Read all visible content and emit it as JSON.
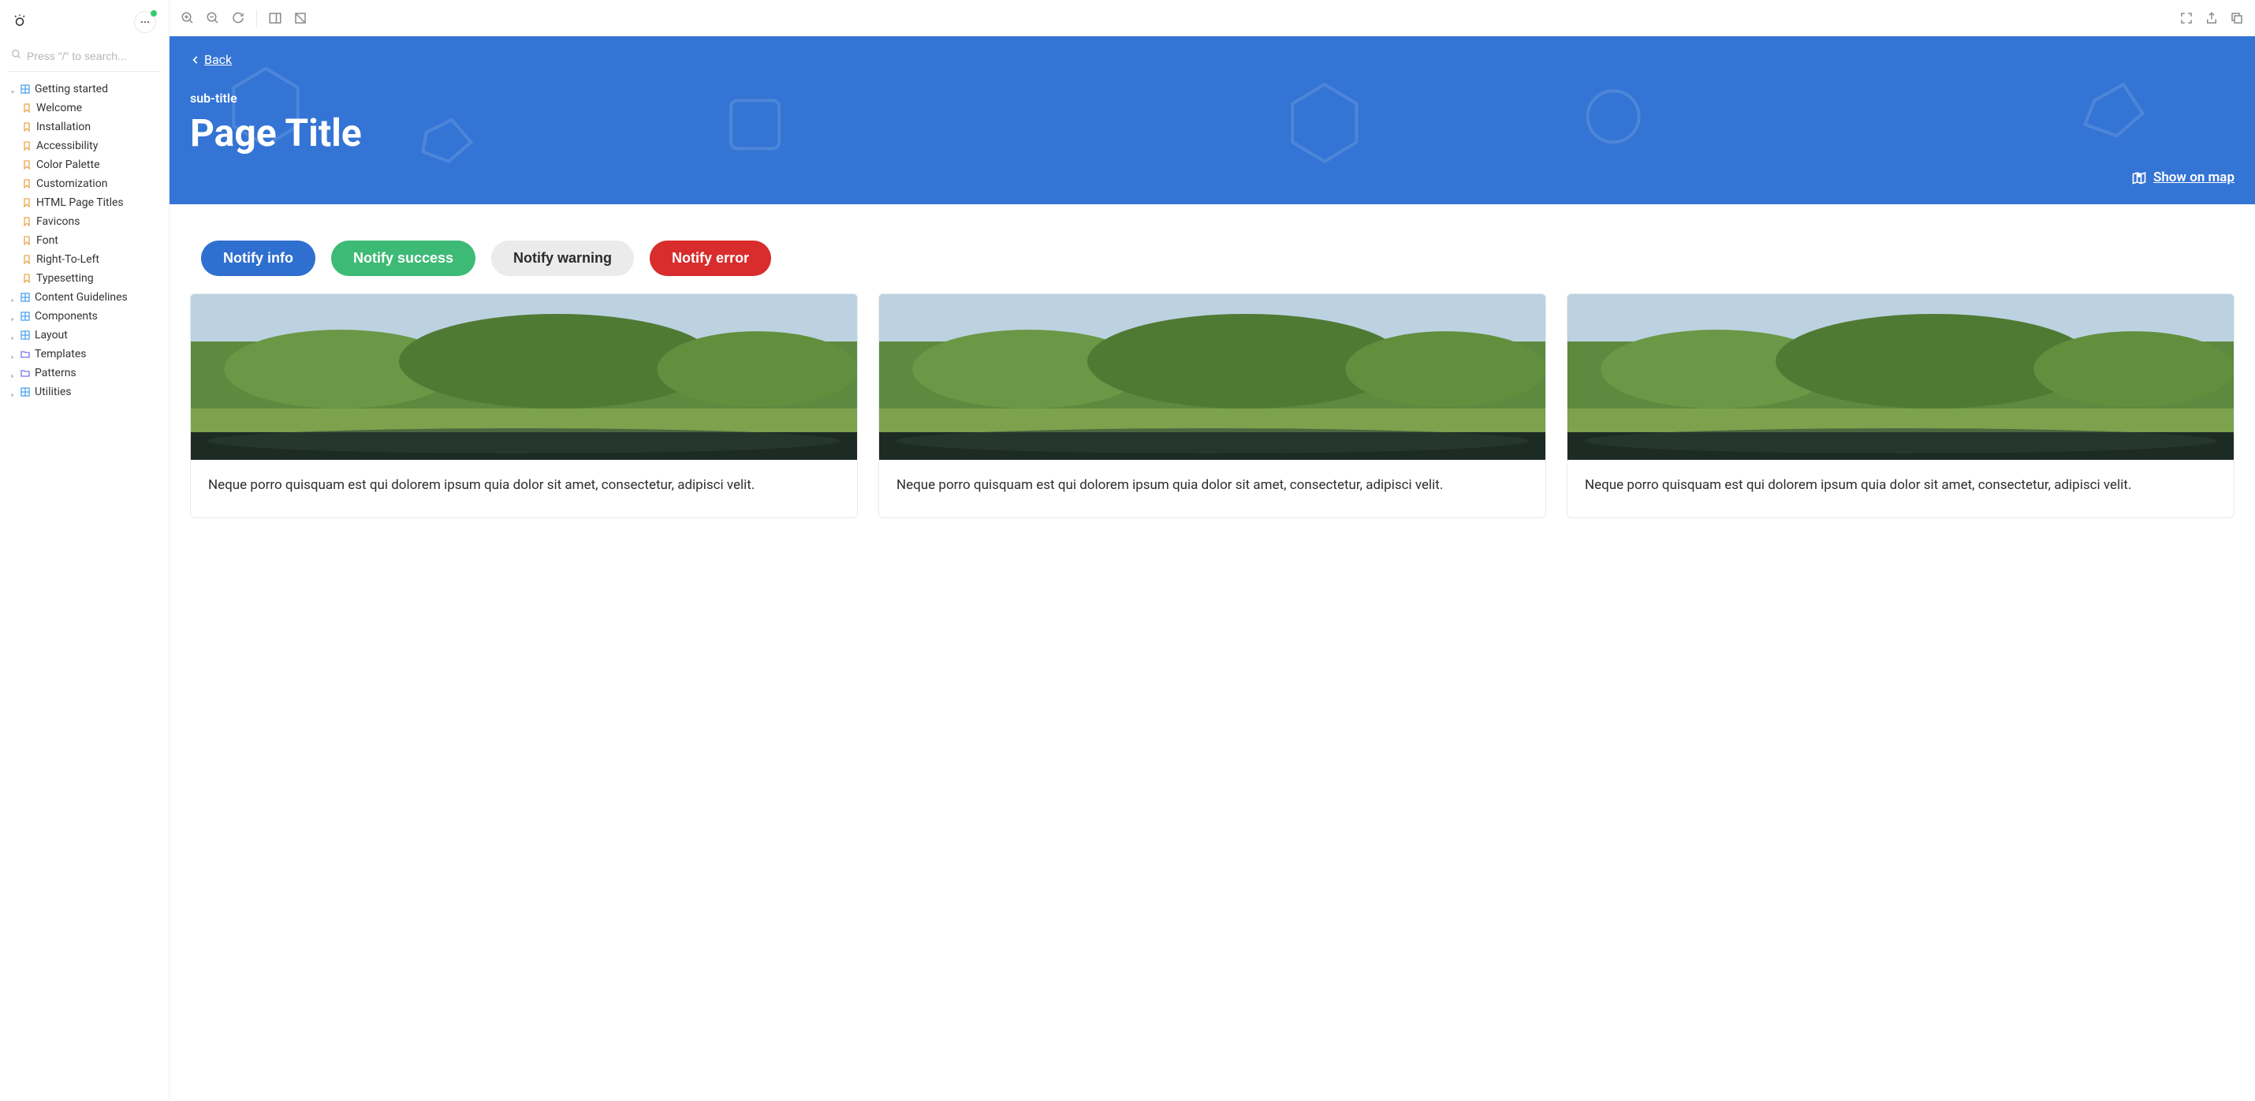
{
  "sidebar": {
    "search_placeholder": "Press \"/\" to search...",
    "groups": [
      {
        "label": "Getting started",
        "icon": "grid",
        "color": "blue",
        "expanded": true,
        "children": [
          {
            "label": "Welcome"
          },
          {
            "label": "Installation"
          },
          {
            "label": "Accessibility"
          },
          {
            "label": "Color Palette"
          },
          {
            "label": "Customization"
          },
          {
            "label": "HTML Page Titles"
          },
          {
            "label": "Favicons"
          },
          {
            "label": "Font"
          },
          {
            "label": "Right-To-Left"
          },
          {
            "label": "Typesetting"
          }
        ]
      },
      {
        "label": "Content Guidelines",
        "icon": "grid",
        "color": "blue"
      },
      {
        "label": "Components",
        "icon": "grid",
        "color": "blue"
      },
      {
        "label": "Layout",
        "icon": "grid",
        "color": "blue"
      },
      {
        "label": "Templates",
        "icon": "folder",
        "color": "purple"
      },
      {
        "label": "Patterns",
        "icon": "folder",
        "color": "purple"
      },
      {
        "label": "Utilities",
        "icon": "grid",
        "color": "blue"
      }
    ]
  },
  "hero": {
    "back_label": "Back",
    "subtitle": "sub-title",
    "title": "Page Title",
    "show_on_map": "Show on map"
  },
  "notify": {
    "info": "Notify info",
    "success": "Notify success",
    "warning": "Notify warning",
    "error": "Notify error"
  },
  "cards": [
    {
      "text": "Neque porro quisquam est qui dolorem ipsum quia dolor sit amet, consectetur, adipisci velit."
    },
    {
      "text": "Neque porro quisquam est qui dolorem ipsum quia dolor sit amet, consectetur, adipisci velit."
    },
    {
      "text": "Neque porro quisquam est qui dolorem ipsum quia dolor sit amet, consectetur, adipisci velit."
    }
  ]
}
